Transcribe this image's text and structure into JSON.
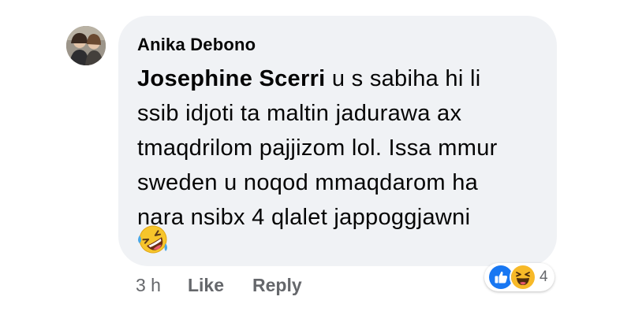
{
  "comment": {
    "author": "Anika Debono",
    "mention": "Josephine Scerri",
    "text_lines": [
      " u s sabiha hi li",
      "ssib idjoti ta maltin jadurawa ax",
      "tmaqdrilom pajjizom lol. Issa mmur",
      "sweden u noqod mmaqdarom ha",
      "nara nsibx 4 qlalet jappoggjawni"
    ],
    "emoji": "rolling-on-the-floor-laughing-emoji",
    "timestamp": "3 h",
    "like_label": "Like",
    "reply_label": "Reply",
    "reactions": {
      "icons": [
        "like-icon",
        "haha-icon"
      ],
      "count": "4"
    }
  },
  "colors": {
    "bubble": "#f0f2f5",
    "text": "#050505",
    "secondary_text": "#65676b",
    "like_blue": "#1877f2",
    "haha_yellow": "#f7b928"
  }
}
